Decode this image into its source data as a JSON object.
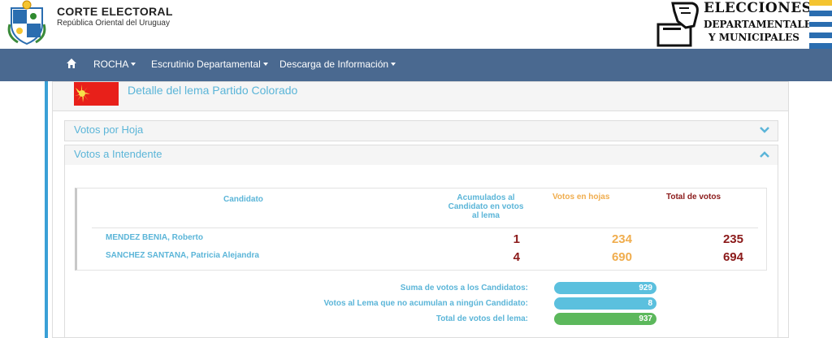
{
  "header": {
    "org_name": "CORTE ELECTORAL",
    "org_sub": "República Oriental del Uruguay",
    "elec_line1": "ELECCIONES",
    "elec_line2": "DEPARTAMENTALES",
    "elec_line3": "Y MUNICIPALES",
    "shield_icon": "uruguay-coat-of-arms",
    "logo_icon": "hand-ballot-box"
  },
  "nav": {
    "home_icon": "home-icon",
    "items": [
      {
        "label": "ROCHA"
      },
      {
        "label": "Escrutinio Departamental"
      },
      {
        "label": "Descarga de Información"
      }
    ]
  },
  "lema": {
    "title": "Detalle del lema Partido Colorado",
    "flag_color": "#e8201a"
  },
  "sections": {
    "votos_hoja": "Votos por Hoja",
    "votos_intendente": "Votos a Intendente"
  },
  "table": {
    "headers": {
      "candidato": "Candidato",
      "acumulados": "Acumulados al Candidato en votos al lema",
      "hojas": "Votos en hojas",
      "total": "Total de votos"
    },
    "rows": [
      {
        "name": "MENDEZ BENIA, Roberto",
        "acumulados": "1",
        "hojas": "234",
        "total": "235"
      },
      {
        "name": "SANCHEZ SANTANA, Patricia Alejandra",
        "acumulados": "4",
        "hojas": "690",
        "total": "694"
      }
    ]
  },
  "summary": {
    "suma_label": "Suma de votos a los Candidatos:",
    "suma_value": "929",
    "no_acum_label": "Votos al Lema que no acumulan a ningún Candidato:",
    "no_acum_value": "8",
    "total_label": "Total de votos del lema:",
    "total_value": "937"
  },
  "colors": {
    "navbar": "#4a6990",
    "accent_blue": "#5bb5d8",
    "orange": "#f0ad4e",
    "dark_red": "#8b1a1a",
    "green": "#5cb85c"
  }
}
